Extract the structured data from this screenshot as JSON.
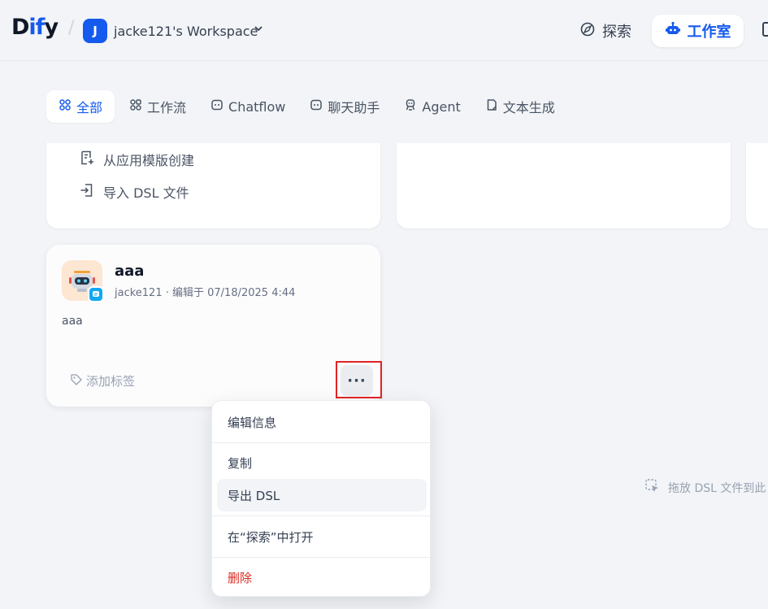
{
  "header": {
    "logo_prefix": "D",
    "logo_accent": "if",
    "logo_suffix": "y",
    "workspace_initial": "J",
    "workspace_name": "jacke121's Workspace",
    "nav_explore": "探索",
    "nav_studio": "工作室"
  },
  "tabs": [
    {
      "label": "全部",
      "icon": "grid-icon",
      "active": true
    },
    {
      "label": "工作流",
      "icon": "workflow-icon"
    },
    {
      "label": "Chatflow",
      "icon": "chatflow-icon"
    },
    {
      "label": "聊天助手",
      "icon": "chat-bot-icon"
    },
    {
      "label": "Agent",
      "icon": "agent-icon"
    },
    {
      "label": "文本生成",
      "icon": "document-icon"
    }
  ],
  "create_card": {
    "from_template": "从应用模版创建",
    "import_dsl": "导入 DSL 文件"
  },
  "app_card": {
    "name": "aaa",
    "meta": "jacke121 · 编辑于 07/18/2025 4:44",
    "description": "aaa",
    "add_tag": "添加标签",
    "more": "···"
  },
  "menu": {
    "edit_info": "编辑信息",
    "duplicate": "复制",
    "export_dsl": "导出 DSL",
    "open_in_explore": "在“探索”中打开",
    "delete": "删除"
  },
  "drop_hint": "拖放 DSL 文件到此",
  "colors": {
    "accent": "#155aef",
    "danger": "#d92d20",
    "highlight": "#e02424"
  }
}
